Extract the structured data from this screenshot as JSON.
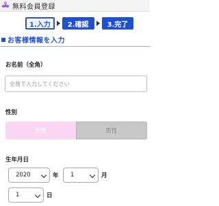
{
  "header": {
    "title": "無料会員登録",
    "logo_icon": "flower-icon"
  },
  "steps": [
    {
      "label": "1.入力",
      "state": "active"
    },
    {
      "label": "2.確認",
      "state": "inactive"
    },
    {
      "label": "3.完了",
      "state": "inactive"
    }
  ],
  "section": {
    "title": "お客様情報を入力"
  },
  "name": {
    "label": "お名前（全角）",
    "placeholder": "全角で入力してください"
  },
  "gender": {
    "label": "性別",
    "female": "女性",
    "male": "男性",
    "selected": "女性"
  },
  "birthday": {
    "label": "生年月日",
    "year": "2020",
    "year_unit": "年",
    "month": "1",
    "month_unit": "月",
    "day": "1",
    "day_unit": "日"
  },
  "colors": {
    "accent": "#1f4fd2",
    "female_bg": "#fbd5f4",
    "male_bg": "#c8c8c8"
  }
}
